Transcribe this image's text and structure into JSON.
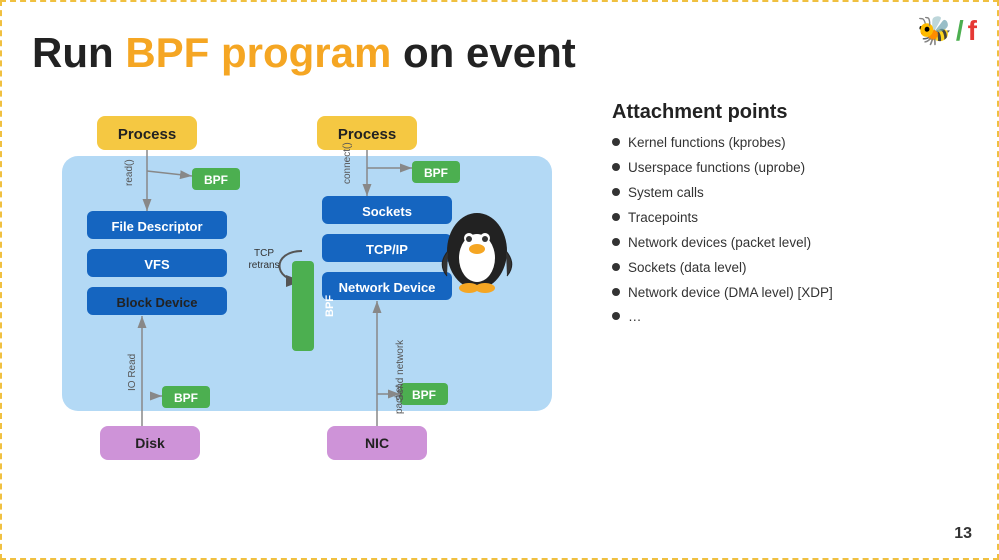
{
  "slide": {
    "title_prefix": "Run ",
    "title_highlight": "BPF program",
    "title_suffix": " on event",
    "page_number": "13"
  },
  "logo": {
    "bee": "🐝",
    "slash": "/",
    "f": "f"
  },
  "diagram": {
    "process_label": "Process",
    "kernel_components_left": [
      "File Descriptor",
      "VFS",
      "Block Device"
    ],
    "kernel_components_right": [
      "Sockets",
      "TCP/IP",
      "Network Device"
    ],
    "bpf_labels": [
      "BPF",
      "BPF",
      "BPF",
      "BPF"
    ],
    "bpf_large_label": "BPF",
    "peripheral_left": "Disk",
    "peripheral_right": "NIC",
    "arrow_labels": {
      "read": "read()",
      "connect": "connect()",
      "io_read": "IO Read",
      "send_network": "Send network\npacket",
      "tcp_retrans": "TCP\nretrans"
    }
  },
  "attachment_points": {
    "title": "Attachment points",
    "items": [
      "Kernel functions (kprobes)",
      "Userspace functions (uprobe)",
      "System calls",
      "Tracepoints",
      "Network devices (packet level)",
      "Sockets (data level)",
      "Network device (DMA level) [XDP]",
      "…"
    ]
  }
}
